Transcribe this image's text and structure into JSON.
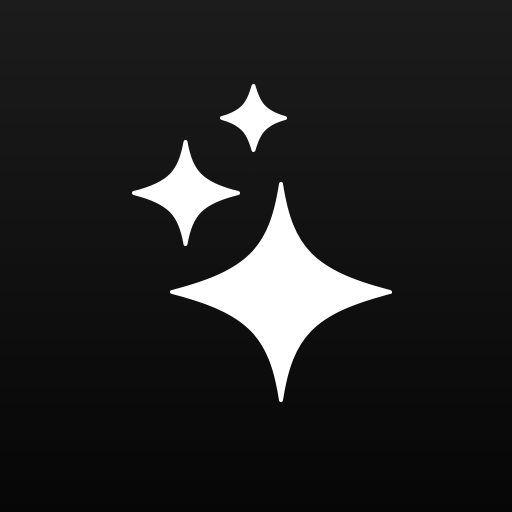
{
  "icon": {
    "name": "sparkles-icon",
    "background_top": "#1c1c1c",
    "background_bottom": "#060606",
    "glyph_color": "#ffffff"
  }
}
